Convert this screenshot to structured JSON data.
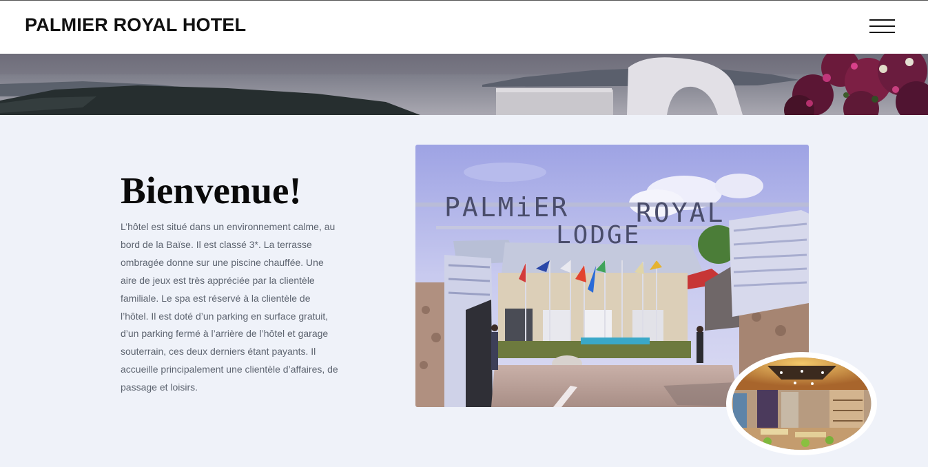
{
  "header": {
    "brand": "PALMIER ROYAL HOTEL",
    "menu_icon": "hamburger-menu-icon"
  },
  "banner": {
    "image_icon": "coastal-landscape-image"
  },
  "welcome": {
    "title": "Bienvenue!",
    "text": "L’hôtel est situé dans un environnement calme, au bord de la Baïse. Il est classé 3*. La terrasse ombragée donne sur une piscine chauffée. Une aire de jeux est très appréciée par la clientèle familiale. Le spa est réservé à la clientèle de l’hôtel. Il est doté d’un parking en surface gratuit, d’un parking fermé à l’arrière de l’hôtel et garage souterrain, ces deux derniers étant payants. Il accueille principalement une clientèle d’affaires, de passage et loisirs."
  },
  "photos": {
    "main_sign_line1": "PALMiER",
    "main_sign_line2": "ROYAL",
    "main_sign_line3": "LODGE",
    "round_icon": "restaurant-interior-image"
  },
  "colors": {
    "page_bg": "#eff2f9",
    "header_bg": "#ffffff",
    "text_body": "#5d6470",
    "heading": "#0a0a0a"
  }
}
